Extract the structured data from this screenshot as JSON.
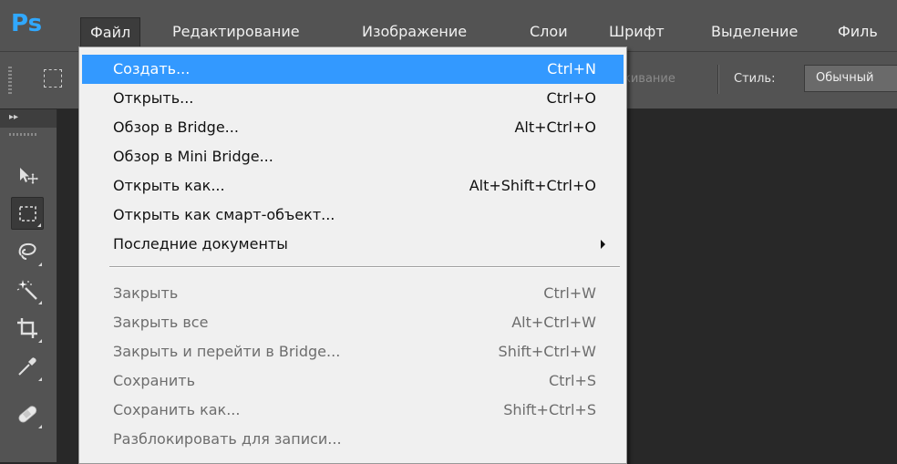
{
  "app": {
    "logo": "Ps",
    "logo_color": "#30a8ff"
  },
  "menubar": {
    "items": [
      {
        "label": "Файл",
        "active": true
      },
      {
        "label": "Редактирование"
      },
      {
        "label": "Изображение"
      },
      {
        "label": "Слои"
      },
      {
        "label": "Шрифт"
      },
      {
        "label": "Выделение"
      },
      {
        "label": "Филь"
      }
    ]
  },
  "options_bar": {
    "faded_text": "кивание",
    "style_label": "Стиль:",
    "style_value": "Обычный"
  },
  "toolbox": {
    "collapse_glyph": "▸▸",
    "tools": [
      {
        "name": "move-tool-icon"
      },
      {
        "name": "rectangular-marquee-tool-icon",
        "selected": true
      },
      {
        "name": "lasso-tool-icon"
      },
      {
        "name": "magic-wand-tool-icon"
      },
      {
        "name": "crop-tool-icon"
      },
      {
        "name": "eyedropper-tool-icon"
      },
      {
        "name": "healing-brush-tool-icon"
      }
    ]
  },
  "file_menu": {
    "highlight_color": "#3399ff",
    "items": [
      {
        "label": "Создать...",
        "shortcut": "Ctrl+N",
        "state": "highlight"
      },
      {
        "label": "Открыть...",
        "shortcut": "Ctrl+O",
        "state": "enabled"
      },
      {
        "label": "Обзор в Bridge...",
        "shortcut": "Alt+Ctrl+O",
        "state": "enabled"
      },
      {
        "label": "Обзор в Mini Bridge...",
        "shortcut": "",
        "state": "enabled"
      },
      {
        "label": "Открыть как...",
        "shortcut": "Alt+Shift+Ctrl+O",
        "state": "enabled"
      },
      {
        "label": "Открыть как смарт-объект...",
        "shortcut": "",
        "state": "enabled"
      },
      {
        "label": "Последние документы",
        "shortcut": "",
        "state": "enabled",
        "submenu": true
      },
      {
        "label": "Закрыть",
        "shortcut": "Ctrl+W",
        "state": "disabled"
      },
      {
        "label": "Закрыть все",
        "shortcut": "Alt+Ctrl+W",
        "state": "disabled"
      },
      {
        "label": "Закрыть и перейти в Bridge...",
        "shortcut": "Shift+Ctrl+W",
        "state": "disabled"
      },
      {
        "label": "Сохранить",
        "shortcut": "Ctrl+S",
        "state": "disabled"
      },
      {
        "label": "Сохранить как...",
        "shortcut": "Shift+Ctrl+S",
        "state": "disabled"
      },
      {
        "label": "Разблокировать для записи...",
        "shortcut": "",
        "state": "disabled"
      }
    ]
  }
}
